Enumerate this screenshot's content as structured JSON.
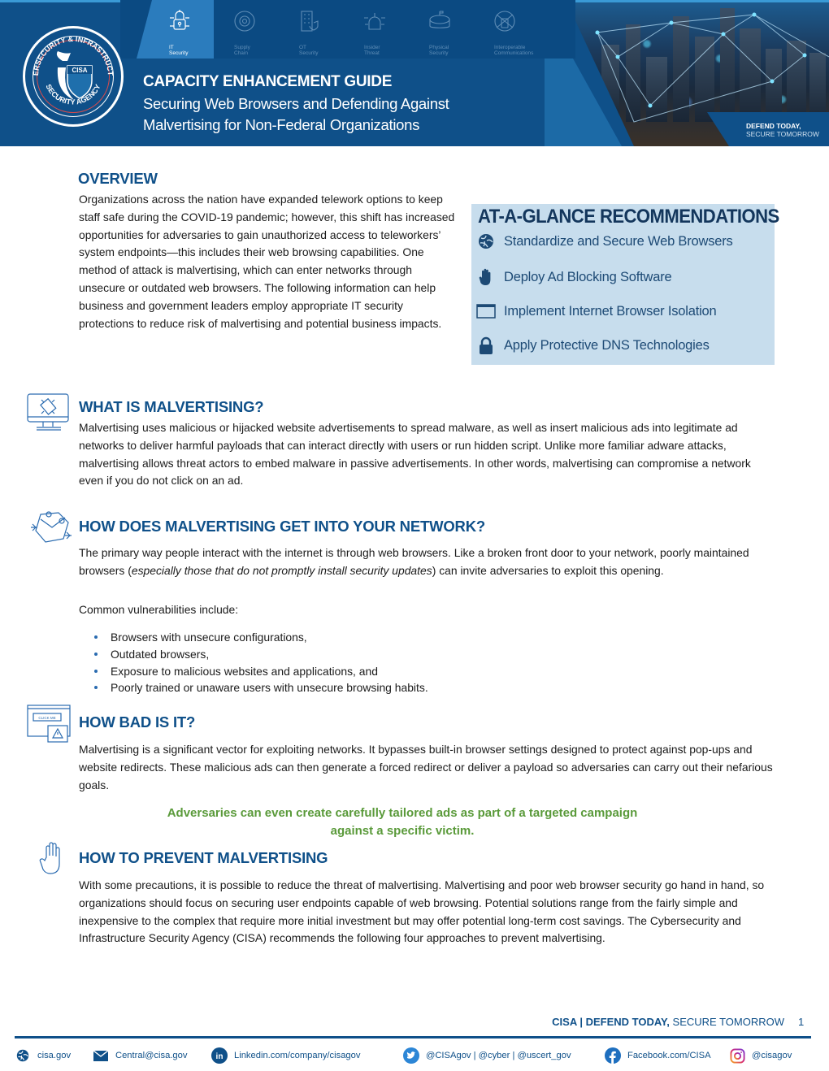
{
  "banner": {
    "seal": {
      "ring_text_top": "CYBERSECURITY & INFRASTRUCTURE",
      "ring_text_bottom": "SECURITY AGENCY",
      "shield_text": "CISA"
    },
    "tabs": [
      {
        "line1": "IT",
        "line2": "Security",
        "icon": "padlock-circuit-icon",
        "active": true
      },
      {
        "line1": "Supply",
        "line2": "Chain",
        "icon": "gear-cycle-icon",
        "active": false
      },
      {
        "line1": "OT",
        "line2": "Security",
        "icon": "building-shield-icon",
        "active": false
      },
      {
        "line1": "Insider",
        "line2": "Threat",
        "icon": "capitol-network-icon",
        "active": false
      },
      {
        "line1": "Physical",
        "line2": "Security",
        "icon": "stadium-icon",
        "active": false
      },
      {
        "line1": "Interoperable",
        "line2": "Communications",
        "icon": "radio-network-icon",
        "active": false
      }
    ],
    "kicker": "CAPACITY ENHANCEMENT GUIDE",
    "title_line1": "Securing Web Browsers and Defending Against",
    "title_line2": "Malvertising for Non-Federal Organizations",
    "tagline_bold": "DEFEND TODAY,",
    "tagline_light": "SECURE TOMORROW"
  },
  "overview": {
    "heading": "OVERVIEW",
    "body": "Organizations across the nation have expanded telework options to keep staff safe during the COVID-19 pandemic; however, this shift has increased opportunities for adversaries to gain unauthorized access to teleworkers’ system endpoints—this includes their web browsing capabilities. One method of attack is malvertising, which can enter networks through unsecure or outdated web browsers. The following information can help business and government leaders employ appropriate IT security protections to reduce risk of malvertising and potential business impacts."
  },
  "at_a_glance": {
    "title": "AT-A-GLANCE RECOMMENDATIONS",
    "items": [
      {
        "icon": "globe-icon",
        "label": "Standardize and Secure Web Browsers"
      },
      {
        "icon": "hand-stop-icon",
        "label": "Deploy Ad Blocking Software"
      },
      {
        "icon": "browser-window-icon",
        "label": "Implement Internet Browser Isolation"
      },
      {
        "icon": "lock-icon",
        "label": "Apply Protective DNS Technologies"
      }
    ]
  },
  "what_is": {
    "heading": "WHAT IS MALVERTISING?",
    "body": "Malvertising uses malicious or hijacked website advertisements to spread malware, as well as insert malicious ads into legitimate ad networks to deliver harmful payloads that can interact directly with users or run hidden script. Unlike more familiar adware attacks, malvertising allows threat actors to embed malware in passive advertisements. In other words, malvertising can compromise a network even if you do not click on an ad."
  },
  "how_does": {
    "heading": "HOW DOES MALVERTISING GET INTO YOUR NETWORK?",
    "body_pre": "The primary way people interact with the internet is through web browsers. Like a broken front door to your network, poorly maintained browsers (",
    "body_italic": "especially those that do not promptly install security updates",
    "body_post": ") can invite adversaries to exploit this opening.",
    "list_intro": "Common vulnerabilities include:",
    "list": [
      "Browsers with unsecure configurations,",
      "Outdated browsers,",
      "Exposure to malicious websites and applications, and",
      "Poorly trained or unaware users with unsecure browsing habits."
    ]
  },
  "how_bad": {
    "heading": "HOW BAD IS IT?",
    "icon_button_text": "CLICK ME",
    "body": "Malvertising is a significant vector for exploiting networks. It bypasses built-in browser settings designed to protect against pop-ups and website redirects. These malicious ads can then generate a forced redirect or deliver a payload so adversaries can carry out their nefarious goals.",
    "callout_line1": "Adversaries can even create carefully tailored ads as part of a targeted campaign",
    "callout_line2": "against a specific victim."
  },
  "prevent": {
    "heading": "HOW TO PREVENT MALVERTISING",
    "body": "With some precautions, it is possible to reduce the threat of malvertising. Malvertising and poor web browser security go hand in hand, so organizations should focus on securing user endpoints capable of web browsing. Potential solutions range from the fairly simple and inexpensive to the complex that require more initial investment but may offer potential long-term cost savings. The Cybersecurity and Infrastructure Security Agency (CISA) recommends the following four approaches to prevent malvertising."
  },
  "footer": {
    "tag_bold": "CISA | DEFEND TODAY,",
    "tag_light": " SECURE TOMORROW",
    "page_number": "1",
    "contacts": [
      {
        "icon": "globe-icon",
        "label": "cisa.gov"
      },
      {
        "icon": "envelope-icon",
        "label": "Central@cisa.gov"
      },
      {
        "icon": "linkedin-icon",
        "label": "Linkedin.com/company/cisagov"
      },
      {
        "icon": "twitter-icon",
        "label": "@CISAgov | @cyber | @uscert_gov"
      },
      {
        "icon": "facebook-icon",
        "label": "Facebook.com/CISA"
      },
      {
        "icon": "instagram-icon",
        "label": "@cisagov"
      }
    ]
  },
  "colors": {
    "brand_blue": "#0f5089",
    "glance_bg": "#c7dded",
    "callout_green": "#5a9a3a"
  }
}
